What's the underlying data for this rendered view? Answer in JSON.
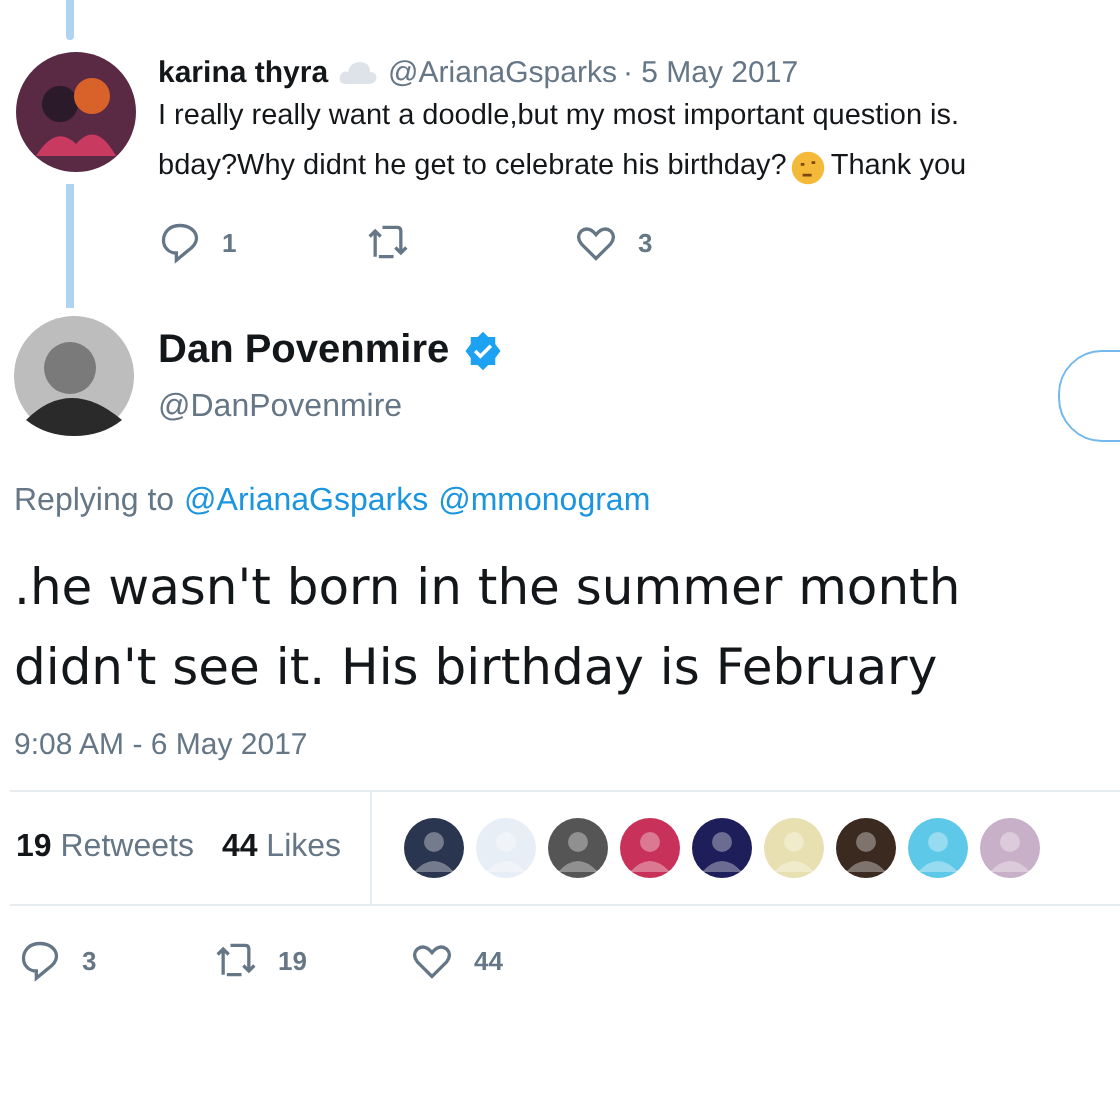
{
  "reply": {
    "name": "karina thyra",
    "handle": "@ArianaGsparks",
    "date": "· 5 May 2017",
    "line_1": "I really really want a doodle,but my most important question is.",
    "line_2_before_emoji": "bday?Why didnt he get to celebrate his birthday?",
    "line_2_after_emoji": "Thank you",
    "actions": [
      {
        "kind": "reply",
        "count": "1"
      },
      {
        "kind": "retweet"
      },
      {
        "kind": "like",
        "count": "3"
      }
    ]
  },
  "tweet": {
    "name": "Dan Povenmire",
    "verified": true,
    "handle": "@DanPovenmire",
    "replying_label": "Replying to",
    "mentions": [
      "@ArianaGsparks",
      "@mmonogram"
    ],
    "lines": [
      ".he wasn't born in the summer month",
      "didn't see it. His birthday is February"
    ],
    "timestamp": "9:08 AM - 6 May 2017",
    "stats": [
      {
        "count": "19",
        "label": "Retweets"
      },
      {
        "count": "44",
        "label": "Likes"
      }
    ],
    "likers": [
      {
        "color": "#2a3550"
      },
      {
        "color": "#e8eef5"
      },
      {
        "color": "#555555"
      },
      {
        "color": "#c8325a"
      },
      {
        "color": "#1e1e5a"
      },
      {
        "color": "#e8e0b0"
      },
      {
        "color": "#3a2a20"
      },
      {
        "color": "#5ec8e8"
      },
      {
        "color": "#c8b0c8"
      }
    ],
    "actions": [
      {
        "kind": "reply",
        "count": "3"
      },
      {
        "kind": "retweet",
        "count": "19"
      },
      {
        "kind": "like",
        "count": "44"
      }
    ]
  }
}
